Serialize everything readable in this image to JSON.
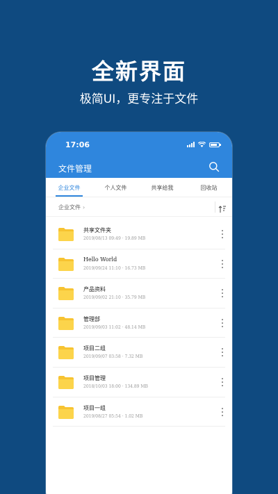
{
  "promo": {
    "title": "全新界面",
    "subtitle": "极简UI，更专注于文件"
  },
  "status": {
    "time": "17:06"
  },
  "app": {
    "title": "文件管理",
    "accent": "#2f86dd"
  },
  "tabs": [
    {
      "label": "企业文件",
      "active": true
    },
    {
      "label": "个人文件",
      "active": false
    },
    {
      "label": "共享给我",
      "active": false
    },
    {
      "label": "回收站",
      "active": false
    }
  ],
  "breadcrumb": {
    "label": "企业文件"
  },
  "files": [
    {
      "name": "共享文件夹",
      "meta": "2019/08/13 09:49 · 19.89 MB"
    },
    {
      "name": "Hello World",
      "meta": "2019/09/24 11:10 · 16.73 MB"
    },
    {
      "name": "产品资料",
      "meta": "2019/09/02 21:10 · 35.79 MB"
    },
    {
      "name": "管理部",
      "meta": "2019/09/03 11:02 · 48.14 MB"
    },
    {
      "name": "项目二组",
      "meta": "2019/09/07 03:58 · 7.32 MB"
    },
    {
      "name": "项目管理",
      "meta": "2018/10/03 18:00 · 134.89 MB"
    },
    {
      "name": "项目一组",
      "meta": "2019/08/27 05:54 · 1.02 MB"
    }
  ]
}
